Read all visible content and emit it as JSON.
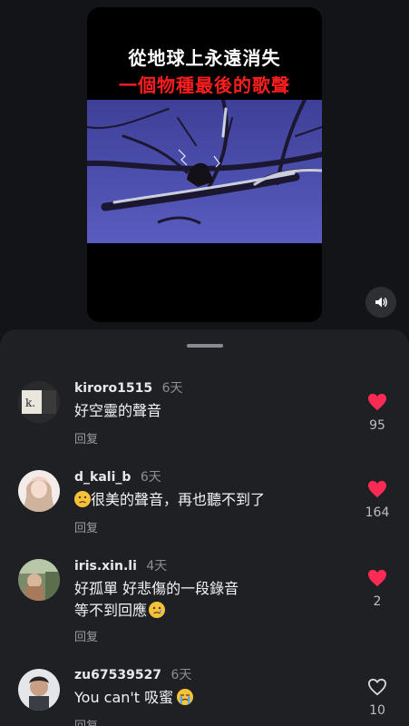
{
  "video": {
    "title_line1": "從地球上永遠消失",
    "title_line2": "一個物種最後的歌聲",
    "title_line2_color": "#ff1e1e"
  },
  "icons": {
    "volume": "speaker-icon",
    "like": "heart-icon",
    "sheet_handle": "drag-handle"
  },
  "colors": {
    "liked": "#fe2c55",
    "sheet_bg": "#1f2024"
  },
  "comments": [
    {
      "user": "kiroro1515",
      "time": "6天",
      "lines": [
        "好空靈的聲音"
      ],
      "reply": "回复",
      "likes": "95",
      "liked": true
    },
    {
      "user": "d_kali_b",
      "time": "6天",
      "lines": [
        "很美的聲音，再也聽不到了"
      ],
      "emoji": "sad-face",
      "reply": "回复",
      "likes": "164",
      "liked": true
    },
    {
      "user": "iris.xin.li",
      "time": "4天",
      "lines": [
        "好孤單 好悲傷的一段錄音",
        "等不到回應"
      ],
      "emoji": "sad-face",
      "reply": "回复",
      "likes": "2",
      "liked": true
    },
    {
      "user": "zu67539527",
      "time": "6天",
      "lines": [
        "You can't 吸蜜"
      ],
      "emoji": "crying-face",
      "reply": "回复",
      "likes": "10",
      "liked": false
    }
  ]
}
